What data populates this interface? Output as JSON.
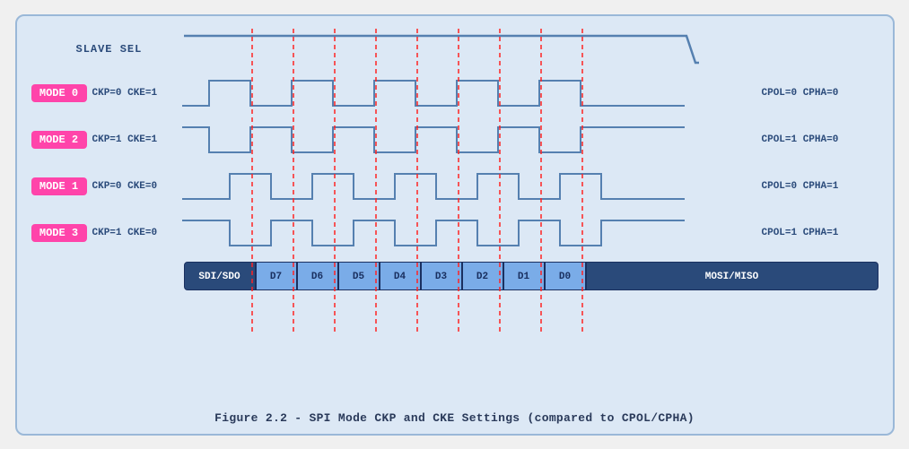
{
  "title": "Figure 2.2 - SPI Mode CKP and CKE Settings (compared to CPOL/CPHA)",
  "slave_label": "SLAVE SEL",
  "modes": [
    {
      "badge": "MODE 0",
      "ckp": "CKP=0 CKE=1",
      "cpol": "CPOL=0 CPHA=0",
      "idle_high": false
    },
    {
      "badge": "MODE 2",
      "ckp": "CKP=1 CKE=1",
      "cpol": "CPOL=1 CPHA=0",
      "idle_high": true
    },
    {
      "badge": "MODE 1",
      "ckp": "CKP=0 CKE=0",
      "cpol": "CPOL=0 CPHA=1",
      "idle_high": false
    },
    {
      "badge": "MODE 3",
      "ckp": "CKP=1 CKE=0",
      "cpol": "CPOL=1 CPHA=1",
      "idle_high": true
    }
  ],
  "data_bits": [
    "SDI/SDO",
    "D7",
    "D6",
    "D5",
    "D4",
    "D3",
    "D2",
    "D1",
    "D0",
    "MOSI/MISO"
  ],
  "caption": "Figure 2.2 - SPI Mode CKP and CKE Settings (compared to CPOL/CPHA)",
  "colors": {
    "signal": "#5580b0",
    "background": "#dce8f5",
    "border": "#9ab8d8",
    "dashed": "#ff2222",
    "dark_blue": "#2a4a7a"
  }
}
